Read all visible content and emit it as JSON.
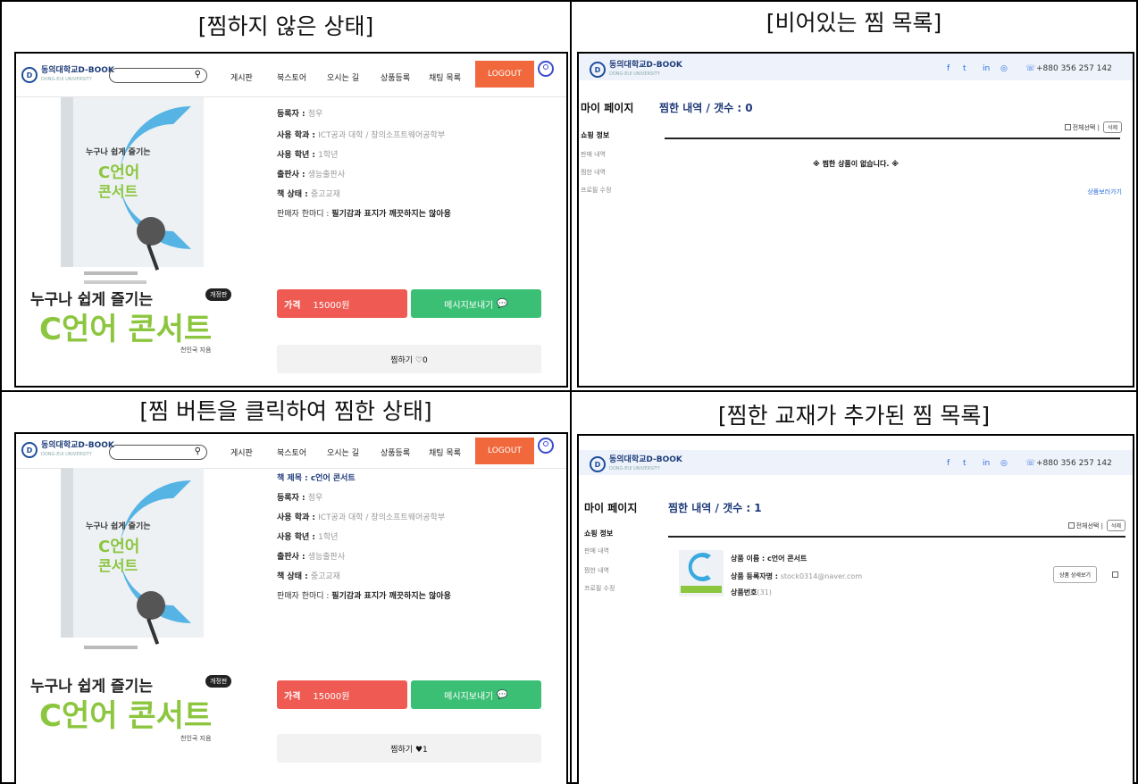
{
  "captions": {
    "tl": "[찜하지 않은 상태]",
    "tr": "[비어있는 찜 목록]",
    "bl": "[찜 버튼을 클릭하여 찜한 상태]",
    "br": "[찜한 교재가 추가된 찜 목록]"
  },
  "colors": {
    "logout": "#f0683c",
    "price": "#ef5b53",
    "message": "#3bbf75",
    "brand": "#1f3d7a"
  },
  "site": {
    "logo_text": "동의대학교D-BOOK",
    "logo_sub": "DONG-EUI UNIVERSITY",
    "phone": "+880 356 257 142"
  },
  "nav": {
    "items": [
      "게시판",
      "북스토어",
      "오시는 길",
      "상품등록",
      "채팅 목록"
    ],
    "logout": "LOGOUT"
  },
  "book": {
    "title_label": "책 제목 : ",
    "title": "c언어 콘서트",
    "fields": [
      {
        "label": "등록자 : ",
        "value": "정우"
      },
      {
        "label": "사용 학과 : ",
        "value": "ICT공과 대학 / 창의소프트웨어공학부"
      },
      {
        "label": "사용 학년 : ",
        "value": "1학년"
      },
      {
        "label": "출판사 : ",
        "value": "생능출판사"
      },
      {
        "label": "책 상태 : ",
        "value": "중고교재"
      }
    ],
    "comment_label": "판매자 한마디 : ",
    "comment": "필기감과 표지가 깨끗하지는 않아용",
    "price_label": "가격",
    "price": "15000원",
    "message_button": "메시지보내기",
    "like_off": "찜하기 ♡0",
    "like_on": "찜하기 ♥1",
    "cover_line1": "누구나 쉽게 즐기는",
    "cover_badge": "개정판",
    "cover_line2": "C언어 콘서트",
    "cover_author": "천인국 지음",
    "cover_small_top": "누구나 쉽게 즐기는",
    "cover_c_title": "C언어",
    "cover_c_title2": "콘서트"
  },
  "mypage": {
    "title": "마이 페이지",
    "side_heading": "쇼핑 정보",
    "side_items": [
      "판매 내역",
      "찜한 내역",
      "프로필 수정"
    ],
    "list_title_empty": "찜한 내역 / 갯수 : 0",
    "list_title_one": "찜한 내역 / 갯수 : 1",
    "select_all": "전체선택 |",
    "delete": "삭제",
    "empty_msg": "※ 찜한 상품이 없습니다. ※",
    "go_shopping": "상품보러가기",
    "item": {
      "name_label": "상품 이름 : ",
      "name": "c언어 콘서트",
      "seller_label": "상품 등록자명 : ",
      "seller": "stock0314@naver.com",
      "id_label": "상품번호",
      "id": "(31)",
      "detail_btn": "상품 상세보기"
    }
  }
}
